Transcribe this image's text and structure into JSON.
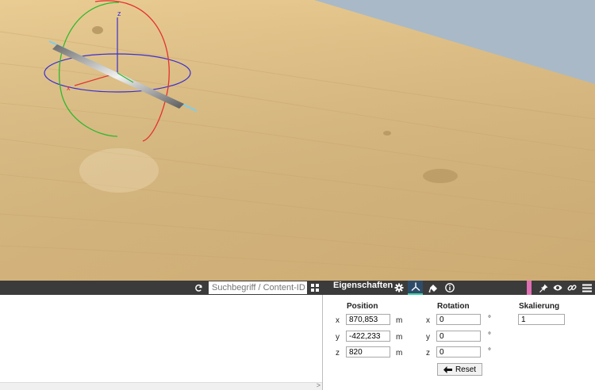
{
  "viewport": {
    "gizmo_labels": {
      "x": "x",
      "z": "z"
    },
    "colors": {
      "sky": "#a9b9c7",
      "ground": "#e3c48d",
      "gizmo_x": "#e53030",
      "gizmo_y": "#2eb82e",
      "gizmo_z": "#3a2fd0",
      "gizmo_handle": "#7ad0ef"
    }
  },
  "toolbar": {
    "refresh_icon": "refresh-icon",
    "search_placeholder": "Suchbegriff / Content-ID",
    "grid_icon": "grid-view-icon",
    "panel_title": "Eigenschaften",
    "tabs": [
      {
        "icon": "gear-icon",
        "active": false
      },
      {
        "icon": "transform-axes-icon",
        "active": true
      },
      {
        "icon": "paint-bucket-icon",
        "active": false
      },
      {
        "icon": "info-icon",
        "active": false
      }
    ],
    "accent_color": "#e06fb3",
    "right_icons": [
      "pin-icon",
      "eye-icon",
      "link-icon",
      "menu-icon"
    ]
  },
  "properties": {
    "position": {
      "label": "Position",
      "axes": [
        "x",
        "y",
        "z"
      ],
      "values": [
        "870,853",
        "-422,233",
        "820"
      ],
      "unit": "m"
    },
    "rotation": {
      "label": "Rotation",
      "axes": [
        "x",
        "y",
        "z"
      ],
      "values": [
        "0",
        "0",
        "0"
      ],
      "unit": "°"
    },
    "scale": {
      "label": "Skalierung",
      "value": "1"
    },
    "reset_label": "Reset"
  },
  "scroll": {
    "arrow": ">"
  }
}
